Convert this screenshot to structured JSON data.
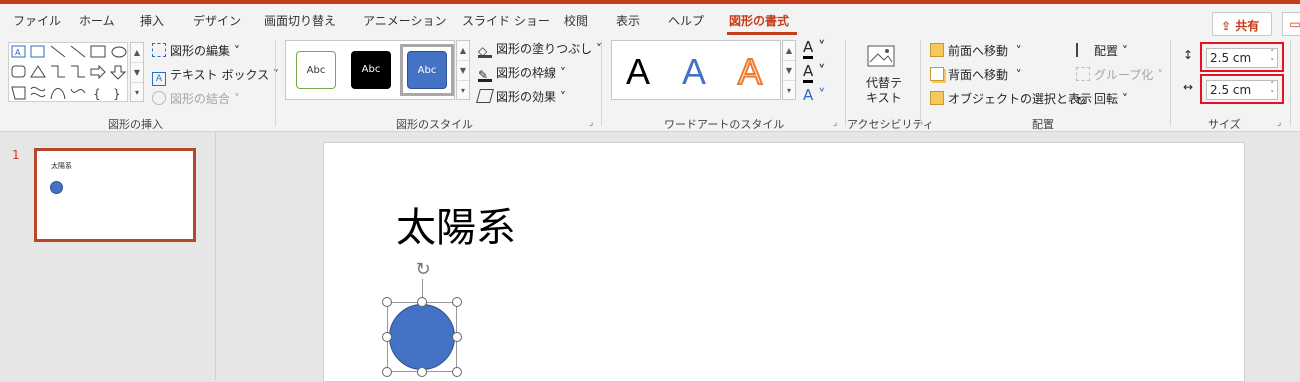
{
  "tabs": [
    {
      "label": "ファイル"
    },
    {
      "label": "ホーム"
    },
    {
      "label": "挿入"
    },
    {
      "label": "デザイン"
    },
    {
      "label": "画面切り替え"
    },
    {
      "label": "アニメーション"
    },
    {
      "label": "スライド ショー"
    },
    {
      "label": "校閲"
    },
    {
      "label": "表示"
    },
    {
      "label": "ヘルプ"
    },
    {
      "label": "図形の書式"
    }
  ],
  "share_label": "共有",
  "colors": {
    "accent": "#c43e1c",
    "shape_fill": "#4472c4",
    "highlight": "#e81123"
  },
  "ribbon": {
    "insert_shapes": {
      "edit_shape": "図形の編集",
      "text_box": "テキスト ボックス",
      "merge_shapes": "図形の結合",
      "group_label": "図形の挿入"
    },
    "shape_styles": {
      "presets": [
        "Abc",
        "Abc",
        "Abc"
      ],
      "fill": "図形の塗りつぶし",
      "outline": "図形の枠線",
      "effects": "図形の効果",
      "group_label": "図形のスタイル"
    },
    "wordart": {
      "letters": [
        "A",
        "A",
        "A"
      ],
      "group_label": "ワードアートのスタイル"
    },
    "accessibility": {
      "alt_text_line1": "代替テ",
      "alt_text_line2": "キスト",
      "group_label": "アクセシビリティ"
    },
    "arrange": {
      "bring_forward": "前面へ移動",
      "send_backward": "背面へ移動",
      "selection_pane": "オブジェクトの選択と表示",
      "align": "配置",
      "group": "グループ化",
      "rotate": "回転",
      "group_label": "配置"
    },
    "size": {
      "height": "2.5 cm",
      "width": "2.5 cm",
      "group_label": "サイズ"
    }
  },
  "slides_pane": {
    "slide_number": "1",
    "thumb_title": "太陽系"
  },
  "slide": {
    "title": "太陽系"
  }
}
